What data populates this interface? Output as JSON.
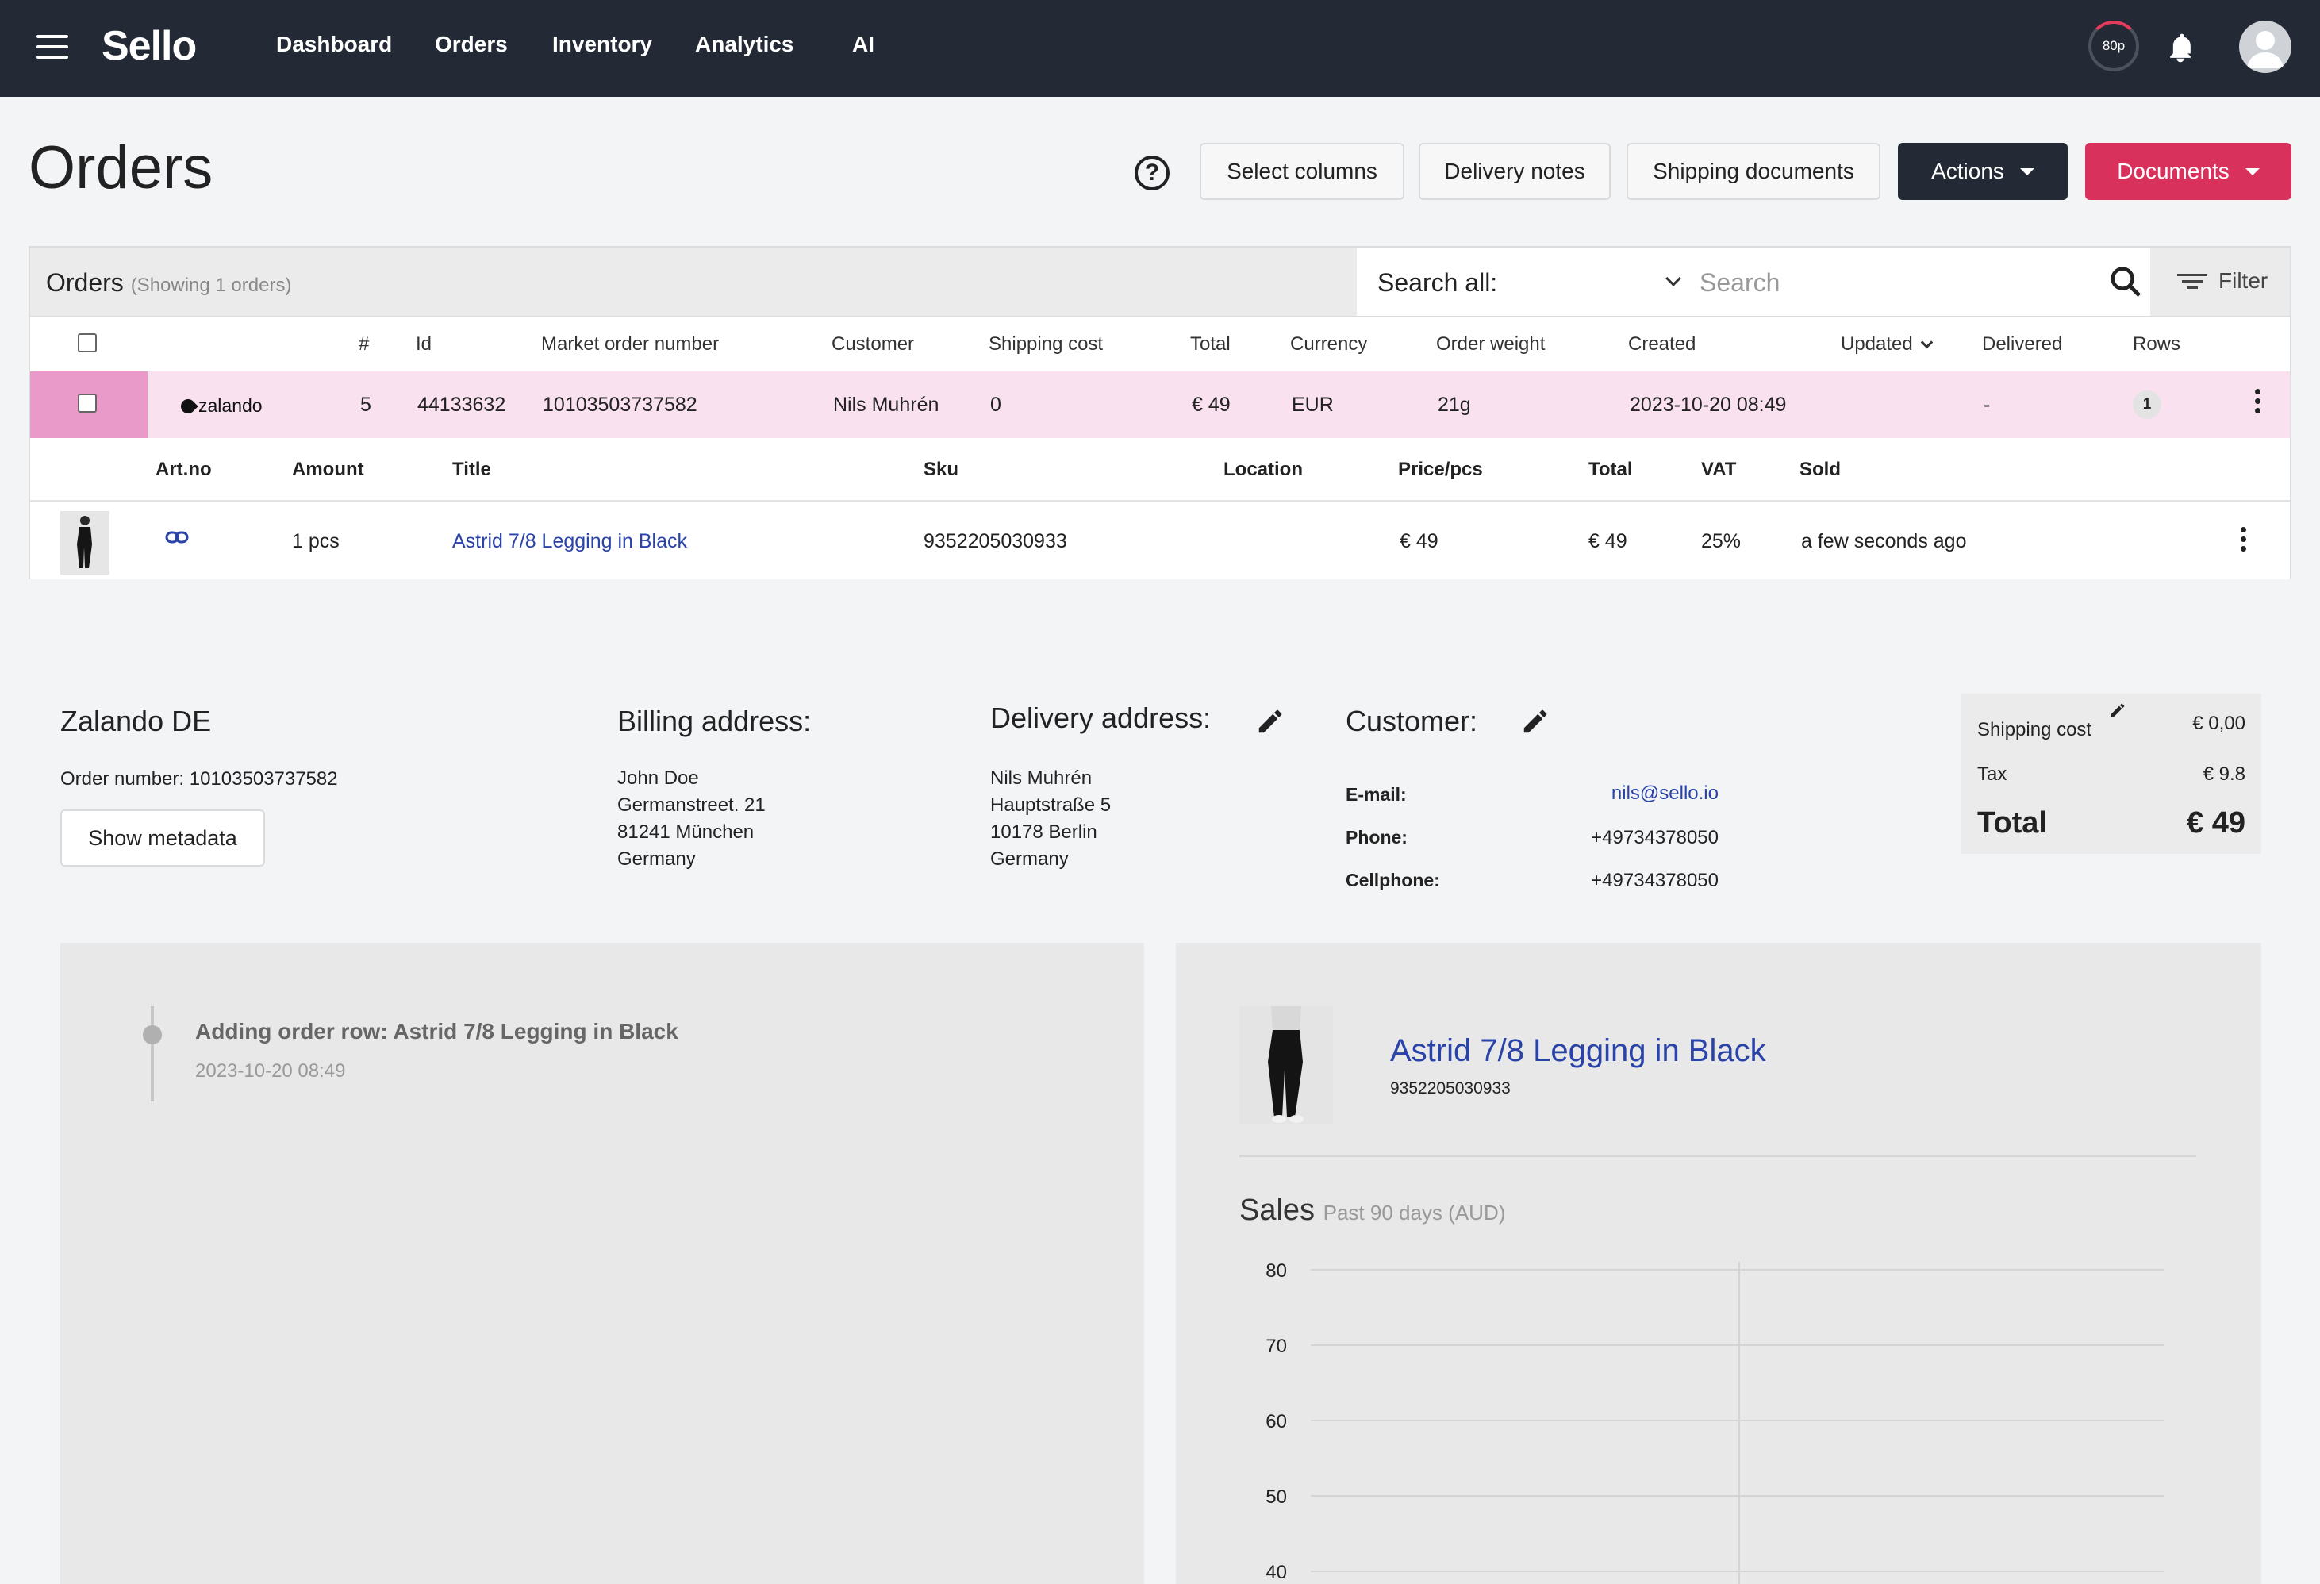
{
  "nav": {
    "logo": "Sello",
    "items": [
      "Dashboard",
      "Orders",
      "Inventory",
      "Analytics",
      "AI"
    ],
    "credits": "80p"
  },
  "header": {
    "title": "Orders",
    "buttons": {
      "select_columns": "Select columns",
      "delivery_notes": "Delivery notes",
      "shipping_documents": "Shipping documents",
      "actions": "Actions",
      "documents": "Documents"
    }
  },
  "orders_panel": {
    "title": "Orders",
    "subtitle": "(Showing 1 orders)",
    "search_scope": "Search all:",
    "search_placeholder": "Search",
    "filter_label": "Filter",
    "columns": [
      "#",
      "Id",
      "Market order number",
      "Customer",
      "Shipping cost",
      "Total",
      "Currency",
      "Order weight",
      "Created",
      "Updated",
      "Delivered",
      "Rows"
    ],
    "order": {
      "market": "zalando",
      "number": "5",
      "id": "44133632",
      "market_order_number": "10103503737582",
      "customer": "Nils Muhrén",
      "shipping_cost": "0",
      "total": "€ 49",
      "currency": "EUR",
      "order_weight": "21g",
      "created": "2023-10-20 08:49",
      "updated": "",
      "delivered": "-",
      "rows": "1"
    },
    "item_columns": [
      "Art.no",
      "Amount",
      "Title",
      "Sku",
      "Location",
      "Price/pcs",
      "Total",
      "VAT",
      "Sold"
    ],
    "item": {
      "amount": "1 pcs",
      "title": "Astrid 7/8 Legging in Black",
      "sku": "9352205030933",
      "location": "",
      "price": "€ 49",
      "total": "€ 49",
      "vat": "25%",
      "sold": "a few seconds ago"
    }
  },
  "details": {
    "shop": "Zalando DE",
    "order_number": "Order number: 10103503737582",
    "show_metadata": "Show metadata",
    "billing": {
      "title": "Billing address:",
      "lines": [
        "John Doe",
        "Germanstreet. 21",
        "81241 München",
        "Germany"
      ]
    },
    "delivery": {
      "title": "Delivery address:",
      "lines": [
        "Nils Muhrén",
        "Hauptstraße 5",
        "10178 Berlin",
        "Germany"
      ]
    },
    "customer": {
      "title": "Customer:",
      "email_label": "E-mail:",
      "email": "nils@sello.io",
      "phone_label": "Phone:",
      "phone": "+49734378050",
      "cellphone_label": "Cellphone:",
      "cellphone": "+49734378050"
    },
    "totals": {
      "shipping_label": "Shipping cost",
      "shipping": "€ 0,00",
      "tax_label": "Tax",
      "tax": "€ 9.8",
      "total_label": "Total",
      "total": "€ 49"
    }
  },
  "log": {
    "entry": "Adding order row: Astrid 7/8 Legging in Black",
    "date": "2023-10-20 08:49"
  },
  "product": {
    "title": "Astrid 7/8 Legging in Black",
    "sku": "9352205030933",
    "sales_title": "Sales",
    "sales_subtitle": "Past 90 days (AUD)"
  },
  "chart_data": {
    "type": "line",
    "title": "Sales",
    "subtitle": "Past 90 days (AUD)",
    "y_ticks": [
      80,
      70,
      60,
      50,
      40
    ],
    "series": [],
    "grid": true
  },
  "colors": {
    "topbar": "#232a35",
    "accent_pink": "#d8315b",
    "row_highlight": "#fae1ef",
    "link_blue": "#2a43a8"
  }
}
